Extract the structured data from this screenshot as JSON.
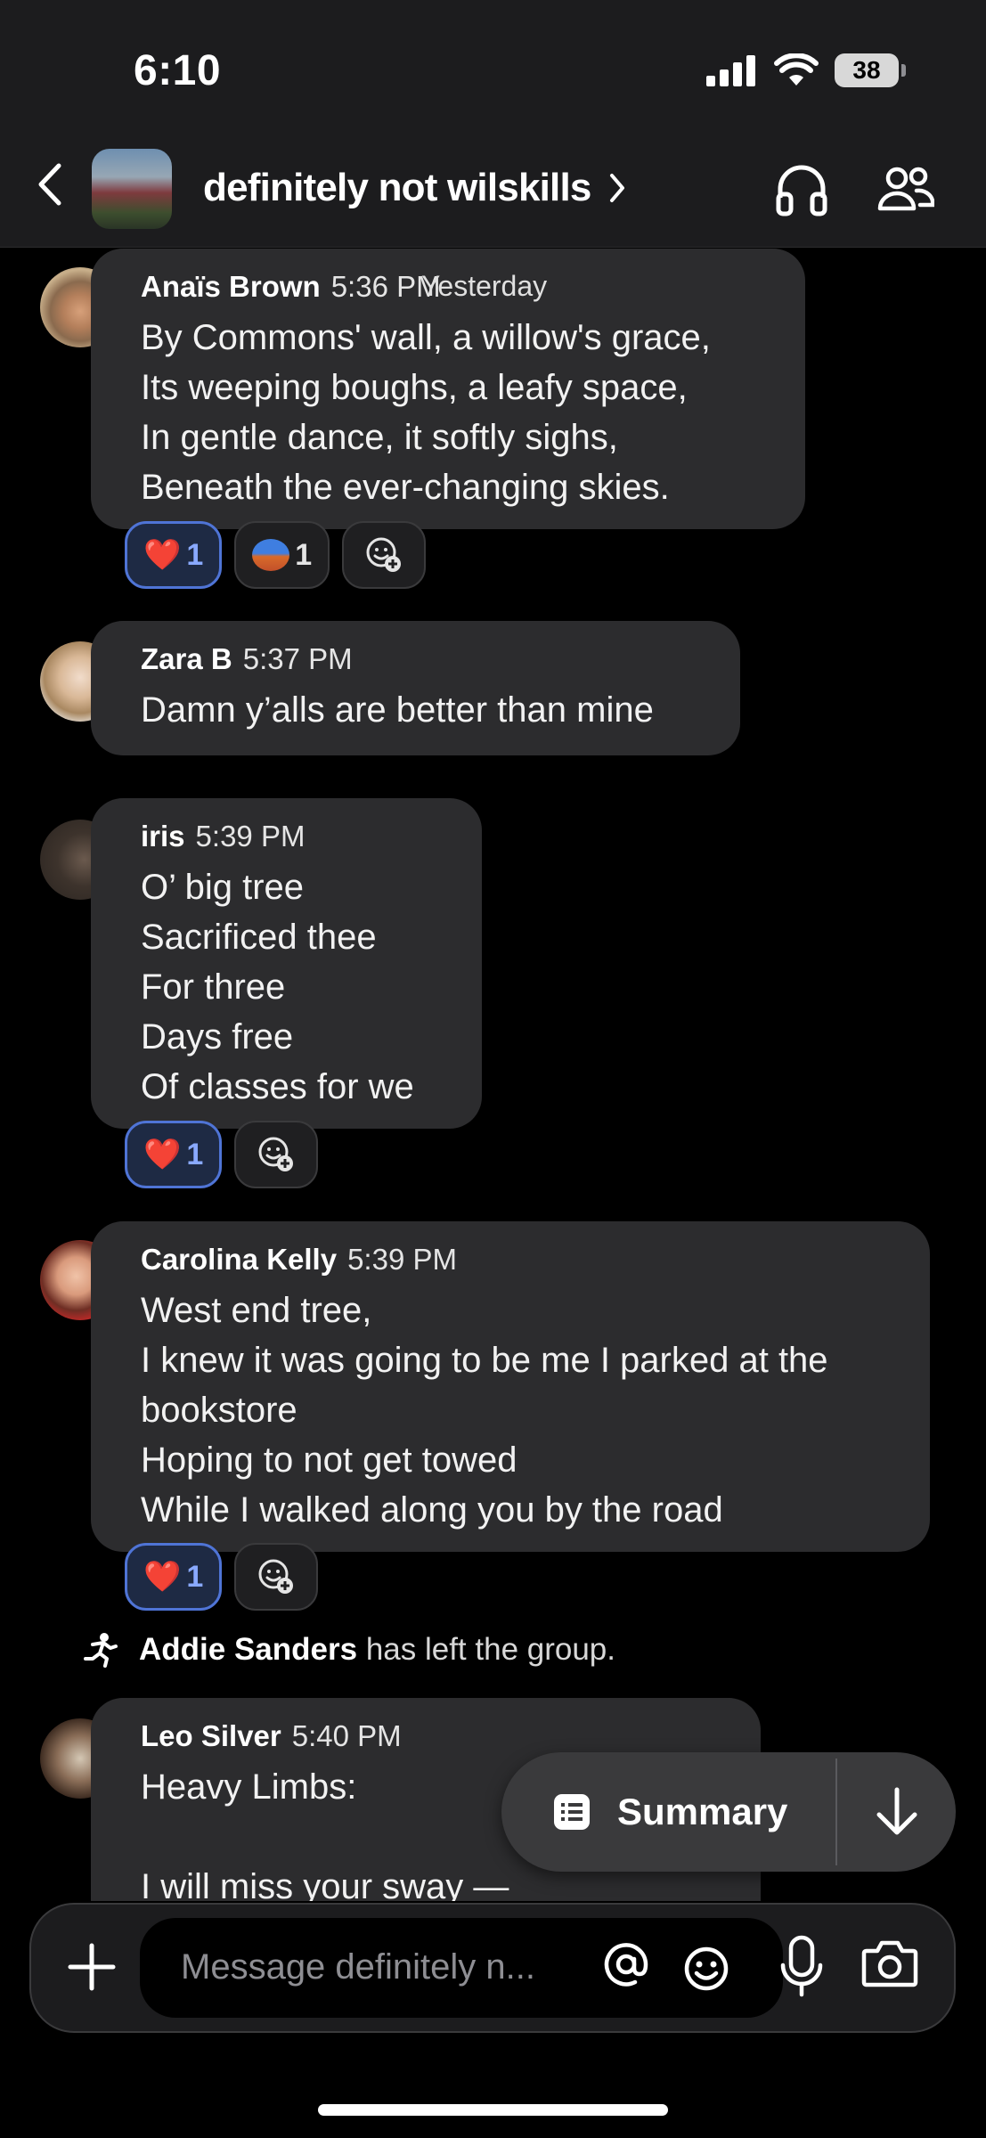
{
  "status_bar": {
    "time": "6:10",
    "battery": "38"
  },
  "header": {
    "group_name": "definitely not wilskills"
  },
  "chat": {
    "date_separator": "Yesterday",
    "messages": [
      {
        "sender": "Anaïs Brown",
        "time": "5:36 PM",
        "text": "By Commons' wall, a willow's grace,\nIts weeping boughs, a leafy space,\nIn gentle dance, it softly sighs,\nBeneath the ever-changing skies.",
        "reactions": [
          {
            "emoji": "❤️",
            "count": "1"
          },
          {
            "emoji": "bikini-emoji",
            "count": "1"
          }
        ]
      },
      {
        "sender": "Zara B",
        "time": "5:37 PM",
        "text": "Damn y’alls are better than mine"
      },
      {
        "sender": "iris",
        "time": "5:39 PM",
        "text": "O’ big tree\nSacrificed thee\nFor three\nDays free\nOf classes for we",
        "reactions": [
          {
            "emoji": "❤️",
            "count": "1"
          }
        ]
      },
      {
        "sender": "Carolina Kelly",
        "time": "5:39 PM",
        "text": "West end tree,\nI knew it was going to be me I parked at the\nbookstore\nHoping to not get towed\nWhile I walked along you by the road",
        "reactions": [
          {
            "emoji": "❤️",
            "count": "1"
          }
        ]
      },
      {
        "sender": "Leo Silver",
        "time": "5:40 PM",
        "text": "Heavy Limbs:\n\nI will miss your sway —"
      }
    ],
    "system_message": {
      "name": "Addie Sanders",
      "text": "has left the group."
    }
  },
  "summary": {
    "label": "Summary"
  },
  "composer": {
    "placeholder": "Message definitely n..."
  },
  "colors": {
    "bubble": "#2c2c2e",
    "reaction_outline": "#4f74d6",
    "background": "#000000"
  }
}
